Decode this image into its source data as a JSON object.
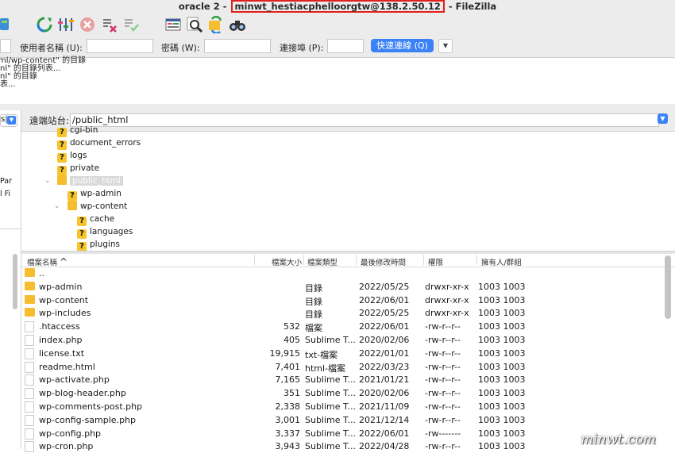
{
  "window": {
    "title_prefix": "oracle 2 - ",
    "title_host": "minwt_hestiacphelloorgtw@138.2.50.12",
    "title_suffix": " - FileZilla"
  },
  "toolbar": {
    "icons": [
      "site-manager-icon",
      "refresh-icon",
      "filter-settings-icon",
      "cancel-icon",
      "disconnect-icon",
      "reconnect-icon",
      "message-log-icon",
      "search-files-icon",
      "sync-browse-icon",
      "binoculars-icon"
    ]
  },
  "quickconnect": {
    "username_label": "使用者名稱 (U):",
    "password_label": "密碼 (W):",
    "port_label": "連接埠 (P):",
    "connect_button": "快速連線 (Q)",
    "username_value": "",
    "password_value": "",
    "port_value": ""
  },
  "log": {
    "lines": [
      "ml/wp-content\" 的目錄",
      "nl\" 的目錄列表...",
      "nl\" 的目錄",
      "表..."
    ]
  },
  "left_panel": {
    "path_fragment": "s|",
    "partial_text": [
      "Par",
      "l Fi"
    ]
  },
  "remote": {
    "label": "遠端站台:",
    "path": "/public_html"
  },
  "tree": {
    "nodes": [
      {
        "name": "cgi-bin",
        "icon": "question-folder-icon"
      },
      {
        "name": "document_errors",
        "icon": "question-folder-icon"
      },
      {
        "name": "logs",
        "icon": "question-folder-icon"
      },
      {
        "name": "private",
        "icon": "question-folder-icon"
      },
      {
        "name": "public_html",
        "icon": "folder-icon",
        "selected": true
      },
      {
        "name": "wp-admin",
        "icon": "question-folder-icon"
      },
      {
        "name": "wp-content",
        "icon": "folder-icon"
      },
      {
        "name": "cache",
        "icon": "question-folder-icon"
      },
      {
        "name": "languages",
        "icon": "question-folder-icon"
      },
      {
        "name": "plugins",
        "icon": "question-folder-icon"
      }
    ]
  },
  "filelist": {
    "headers": {
      "name": "檔案名稱",
      "size": "檔案大小",
      "type": "檔案類型",
      "modified": "最後修改時間",
      "perms": "權限",
      "owner": "擁有人/群組"
    },
    "sort_indicator": "^",
    "rows": [
      {
        "name": "..",
        "size": "",
        "type": "",
        "modified": "",
        "perms": "",
        "owner": "",
        "kind": "folder"
      },
      {
        "name": "wp-admin",
        "size": "",
        "type": "目錄",
        "modified": "2022/05/25",
        "perms": "drwxr-xr-x",
        "owner": "1003 1003",
        "kind": "folder"
      },
      {
        "name": "wp-content",
        "size": "",
        "type": "目錄",
        "modified": "2022/06/01",
        "perms": "drwxr-xr-x",
        "owner": "1003 1003",
        "kind": "folder"
      },
      {
        "name": "wp-includes",
        "size": "",
        "type": "目錄",
        "modified": "2022/05/25",
        "perms": "drwxr-xr-x",
        "owner": "1003 1003",
        "kind": "folder"
      },
      {
        "name": ".htaccess",
        "size": "532",
        "type": "檔案",
        "modified": "2022/06/01",
        "perms": "-rw-r--r--",
        "owner": "1003 1003",
        "kind": "file"
      },
      {
        "name": "index.php",
        "size": "405",
        "type": "Sublime T...",
        "modified": "2020/02/06",
        "perms": "-rw-r--r--",
        "owner": "1003 1003",
        "kind": "file"
      },
      {
        "name": "license.txt",
        "size": "19,915",
        "type": "txt-檔案",
        "modified": "2022/01/01",
        "perms": "-rw-r--r--",
        "owner": "1003 1003",
        "kind": "file"
      },
      {
        "name": "readme.html",
        "size": "7,401",
        "type": "html-檔案",
        "modified": "2022/03/23",
        "perms": "-rw-r--r--",
        "owner": "1003 1003",
        "kind": "file"
      },
      {
        "name": "wp-activate.php",
        "size": "7,165",
        "type": "Sublime T...",
        "modified": "2021/01/21",
        "perms": "-rw-r--r--",
        "owner": "1003 1003",
        "kind": "file"
      },
      {
        "name": "wp-blog-header.php",
        "size": "351",
        "type": "Sublime T...",
        "modified": "2020/02/06",
        "perms": "-rw-r--r--",
        "owner": "1003 1003",
        "kind": "file"
      },
      {
        "name": "wp-comments-post.php",
        "size": "2,338",
        "type": "Sublime T...",
        "modified": "2021/11/09",
        "perms": "-rw-r--r--",
        "owner": "1003 1003",
        "kind": "file"
      },
      {
        "name": "wp-config-sample.php",
        "size": "3,001",
        "type": "Sublime T...",
        "modified": "2021/12/14",
        "perms": "-rw-r--r--",
        "owner": "1003 1003",
        "kind": "file"
      },
      {
        "name": "wp-config.php",
        "size": "3,337",
        "type": "Sublime T...",
        "modified": "2022/06/01",
        "perms": "-rw-------",
        "owner": "1003 1003",
        "kind": "file"
      },
      {
        "name": "wp-cron.php",
        "size": "3,943",
        "type": "Sublime T...",
        "modified": "2022/04/28",
        "perms": "-rw-r--r--",
        "owner": "1003 1003",
        "kind": "file"
      }
    ]
  },
  "watermark": "minwt.com",
  "colors": {
    "accent": "#3b82f6",
    "highlight_border": "#e0201a",
    "folder": "#f6bd2f",
    "chrome": "#ececec"
  }
}
